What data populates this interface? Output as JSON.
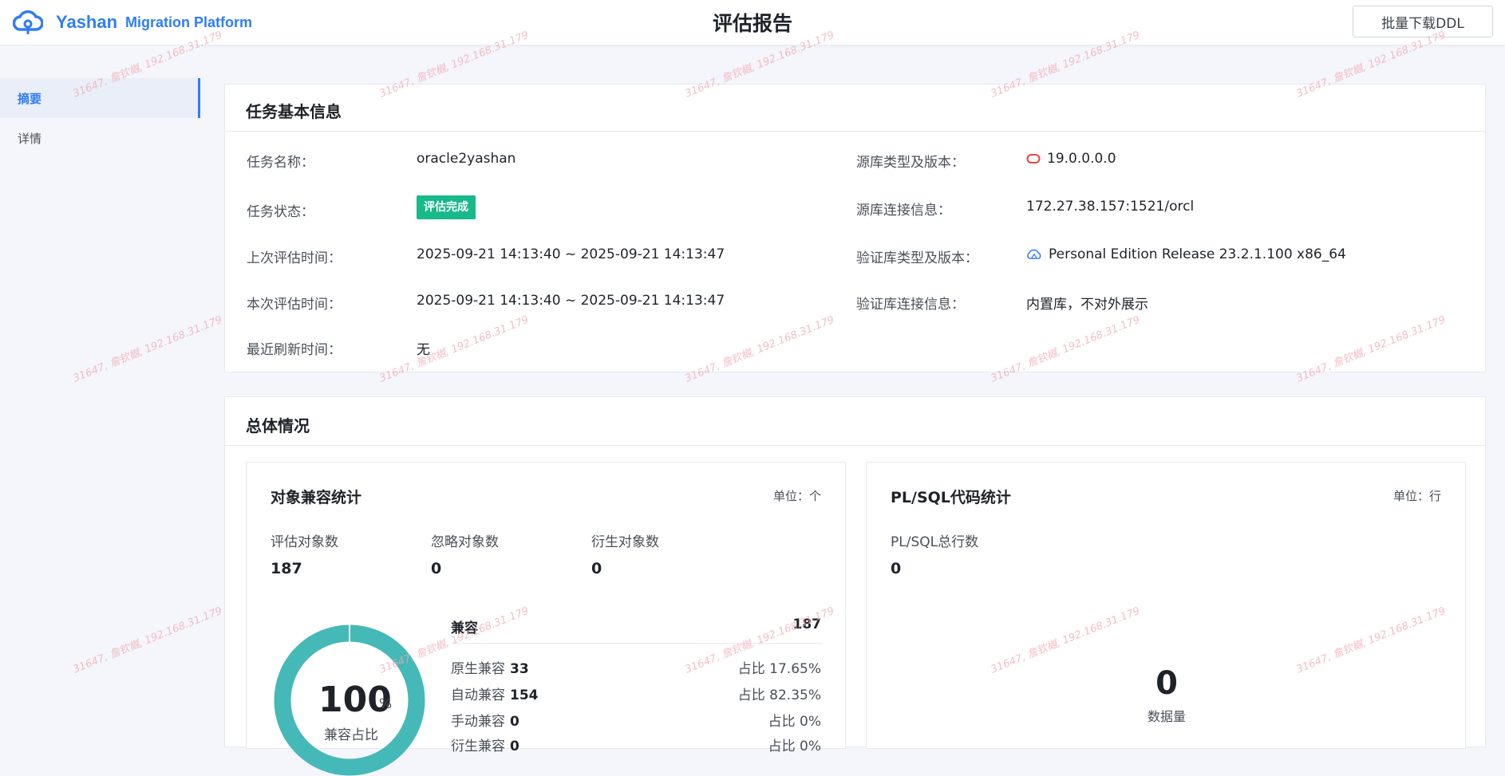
{
  "header": {
    "brand": "Yashan",
    "subtitle": "Migration Platform",
    "page_title": "评估报告",
    "download_button": "批量下载DDL"
  },
  "sidebar": {
    "items": [
      {
        "label": "摘要",
        "active": true
      },
      {
        "label": "详情",
        "active": false
      }
    ]
  },
  "task_info": {
    "title": "任务基本信息",
    "left": [
      {
        "label": "任务名称：",
        "value": "oracle2yashan"
      },
      {
        "label": "任务状态：",
        "value": "评估完成"
      },
      {
        "label": "上次评估时间：",
        "value": "2025-09-21 14:13:40 ~ 2025-09-21 14:13:47"
      },
      {
        "label": "本次评估时间：",
        "value": "2025-09-21 14:13:40 ~ 2025-09-21 14:13:47"
      },
      {
        "label": "最近刷新时间：",
        "value": "无"
      }
    ],
    "right": [
      {
        "label": "源库类型及版本：",
        "value": "19.0.0.0.0",
        "icon": "oracle-icon"
      },
      {
        "label": "源库连接信息：",
        "value": "172.27.38.157:1521/orcl"
      },
      {
        "label": "验证库类型及版本：",
        "value": "Personal Edition Release 23.2.1.100 x86_64",
        "icon": "yashan-cloud-icon"
      },
      {
        "label": "验证库连接信息：",
        "value": "内置库，不对外展示"
      }
    ]
  },
  "overview": {
    "title": "总体情况",
    "object_stats": {
      "title": "对象兼容统计",
      "unit": "单位：个",
      "stats": [
        {
          "label": "评估对象数",
          "value": "187"
        },
        {
          "label": "忽略对象数",
          "value": "0"
        },
        {
          "label": "衍生对象数",
          "value": "0"
        }
      ],
      "donut": {
        "value": "100",
        "unit": "%",
        "label": "兼容占比",
        "percent": 100
      },
      "compat_total_label": "兼容",
      "compat_total_value": "187",
      "rows": [
        {
          "label": "原生兼容",
          "value": "33",
          "pct": "占比 17.65%"
        },
        {
          "label": "自动兼容",
          "value": "154",
          "pct": "占比 82.35%"
        },
        {
          "label": "手动兼容",
          "value": "0",
          "pct": "占比 0%"
        },
        {
          "label": "衍生兼容",
          "value": "0",
          "pct": "占比 0%"
        }
      ]
    },
    "plsql_stats": {
      "title": "PL/SQL代码统计",
      "unit": "单位：行",
      "total_label": "PL/SQL总行数",
      "total_value": "0",
      "center_value": "0",
      "center_label": "数据量"
    }
  },
  "watermark": "31647, 詹钦樾, 192.168.31.179",
  "colors": {
    "accent": "#2f7df6",
    "status_green": "#18b98b",
    "donut": "#45b9b7",
    "oracle_red": "#e0443a"
  }
}
